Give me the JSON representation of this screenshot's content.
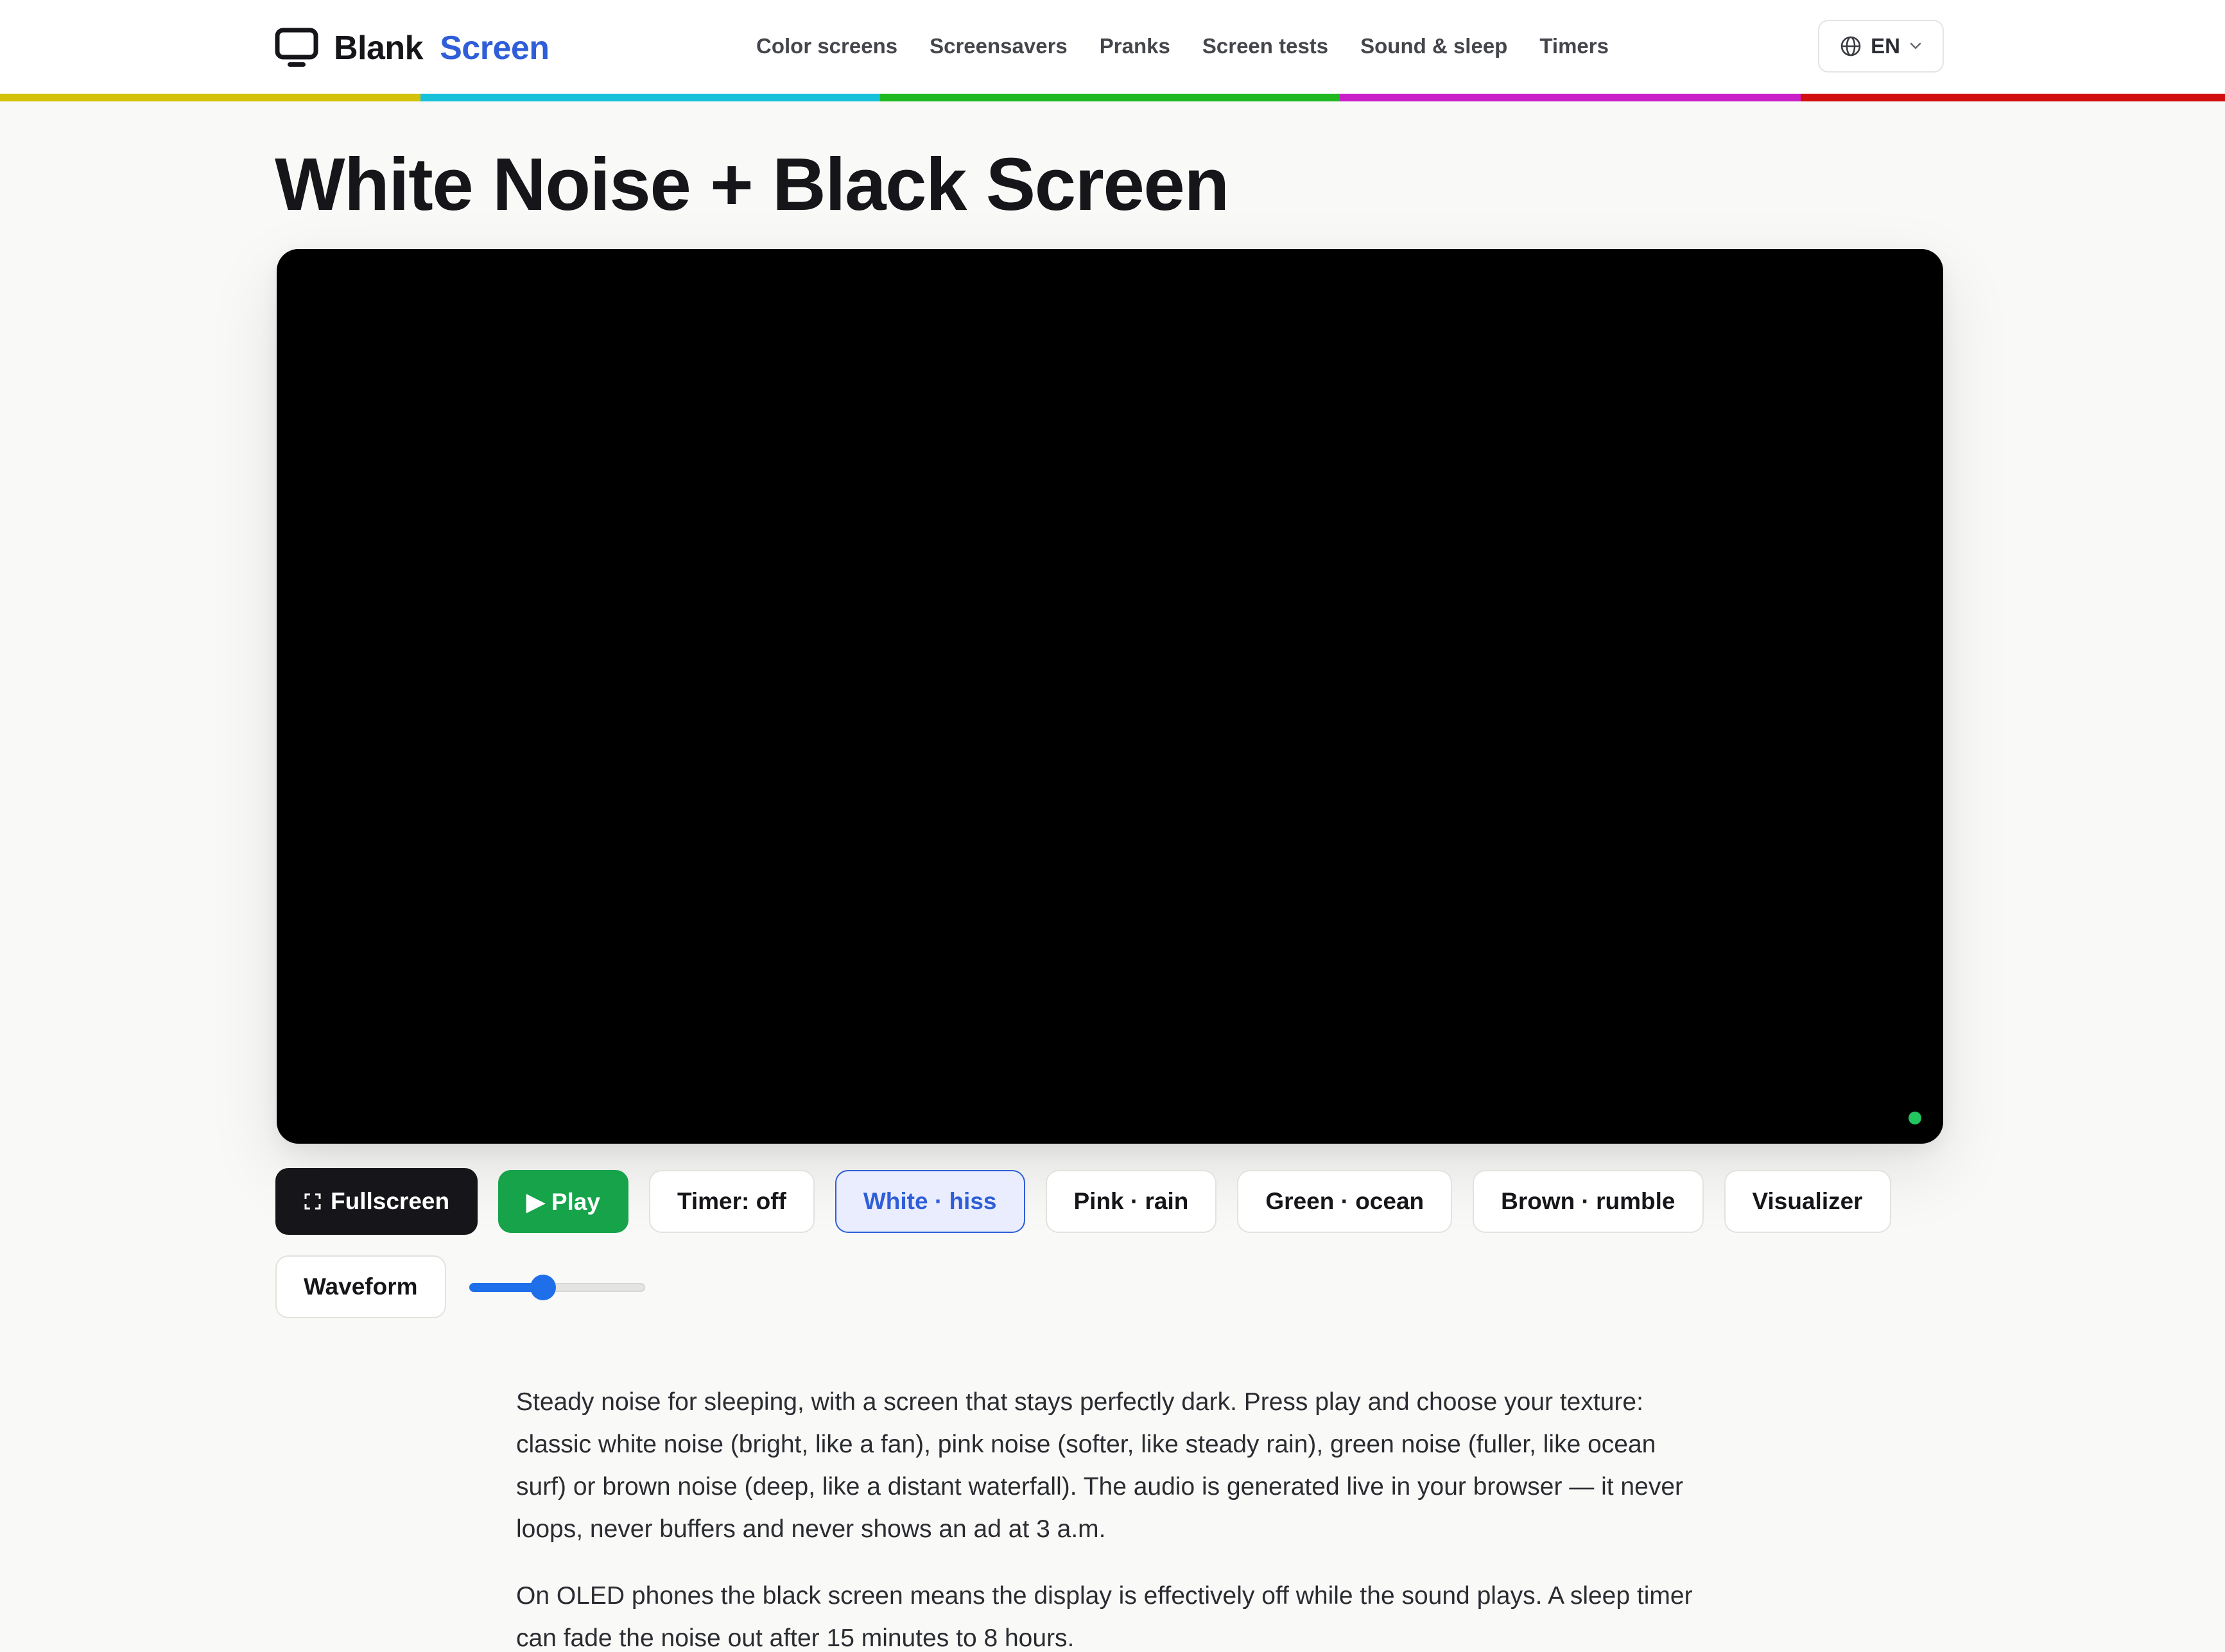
{
  "brand": {
    "word1": "Blank",
    "word2": "Screen"
  },
  "nav": [
    {
      "label": "Color screens"
    },
    {
      "label": "Screensavers"
    },
    {
      "label": "Pranks"
    },
    {
      "label": "Screen tests"
    },
    {
      "label": "Sound & sleep"
    },
    {
      "label": "Timers"
    }
  ],
  "language": {
    "label": "EN"
  },
  "colors": {
    "brand_blue": "#2f5ed8",
    "play_green": "#16a34a",
    "rainbow": [
      "#d4c20a",
      "#16c0d8",
      "#1fb821",
      "#c81fc8",
      "#d10f0f"
    ]
  },
  "page": {
    "title": "White Noise + Black Screen"
  },
  "controls": {
    "fullscreen": "Fullscreen",
    "play": "▶ Play",
    "timer": "Timer: off",
    "noise_types": [
      {
        "label": "White · hiss",
        "selected": true
      },
      {
        "label": "Pink · rain",
        "selected": false
      },
      {
        "label": "Green · ocean",
        "selected": false
      },
      {
        "label": "Brown · rumble",
        "selected": false
      }
    ],
    "visualizer": "Visualizer",
    "waveform": "Waveform",
    "volume": 0.42
  },
  "content": {
    "paragraphs": [
      "Steady noise for sleeping, with a screen that stays perfectly dark. Press play and choose your texture: classic white noise (bright, like a fan), pink noise (softer, like steady rain), green noise (fuller, like ocean surf) or brown noise (deep, like a distant waterfall). The audio is generated live in your browser — it never loops, never buffers and never shows an ad at 3 a.m.",
      "On OLED phones the black screen means the display is effectively off while the sound plays. A sleep timer can fade the noise out after 15 minutes to 8 hours."
    ]
  }
}
